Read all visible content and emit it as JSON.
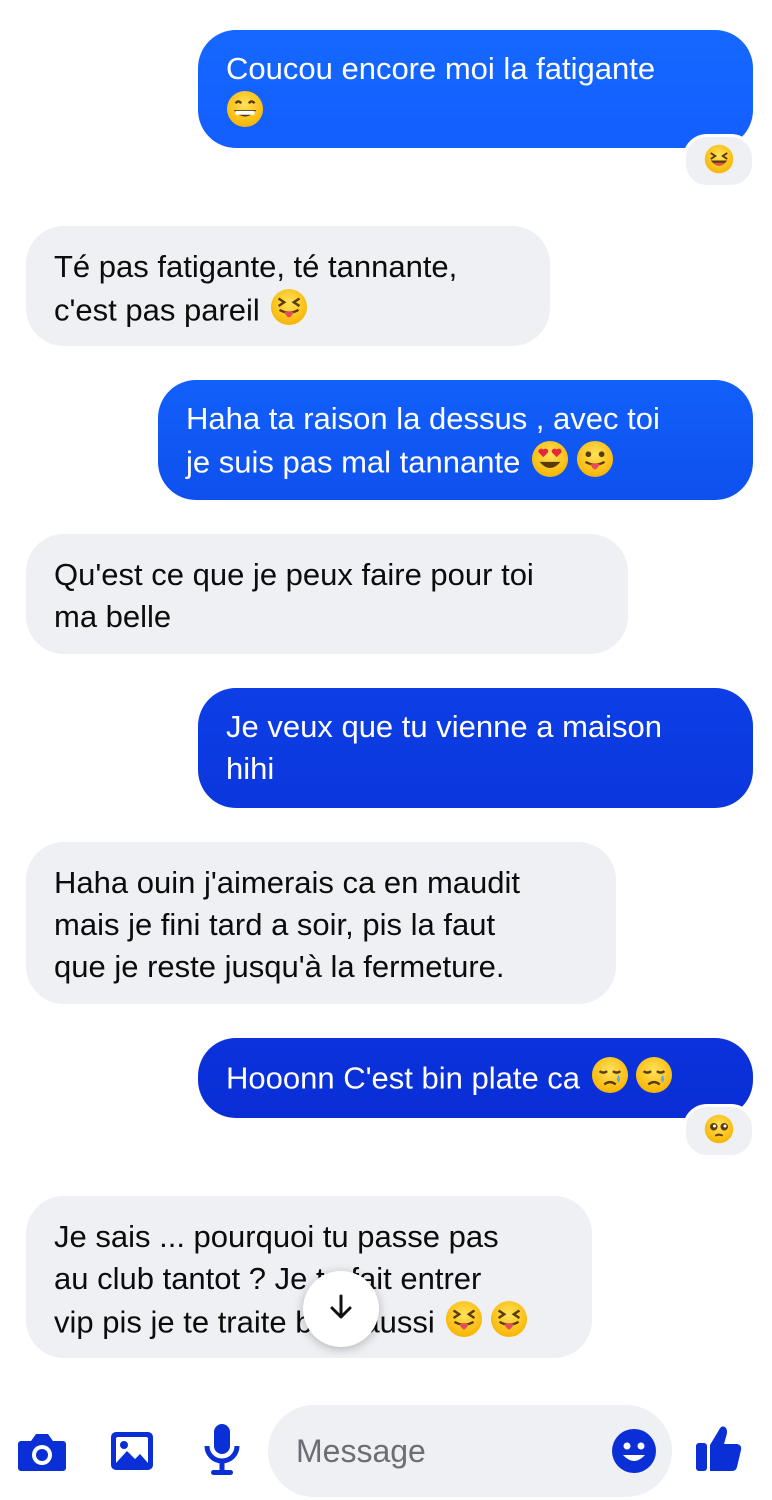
{
  "conversation": {
    "messages": [
      {
        "from": "me",
        "lines": [
          "Coucou encore moi la fatigante",
          ""
        ],
        "emojis": [
          "grinning-face"
        ],
        "reaction": "laughing-face"
      },
      {
        "from": "them",
        "lines": [
          "Té pas fatigante,  té tannante,",
          "c'est pas pareil"
        ],
        "emojis": [
          "squinting-tongue-face"
        ]
      },
      {
        "from": "me",
        "lines": [
          "Haha ta raison la dessus , avec toi",
          "je suis pas mal tannante"
        ],
        "emojis": [
          "heart-eyes-face",
          "tongue-face"
        ]
      },
      {
        "from": "them",
        "lines": [
          "Qu'est ce que je peux faire pour toi",
          "ma belle"
        ]
      },
      {
        "from": "me",
        "lines": [
          "Je veux que tu vienne a maison",
          "hihi"
        ]
      },
      {
        "from": "them",
        "lines": [
          "Haha ouin j'aimerais ca en maudit",
          "mais je fini tard a soir, pis la faut",
          "que je reste jusqu'à  la fermeture."
        ]
      },
      {
        "from": "me",
        "lines": [
          "Hooonn C'est bin plate ca"
        ],
        "emojis": [
          "sad-tear-face",
          "sad-tear-face"
        ],
        "reaction": "pleading-face"
      },
      {
        "from": "them",
        "lines": [
          "Je sais ... pourquoi tu passe pas",
          "au club tantot ? Je te fait entrer",
          "vip pis je te traite bien aussi"
        ],
        "emojis": [
          "squinting-tongue-face",
          "squinting-tongue-face"
        ]
      }
    ]
  },
  "composer": {
    "placeholder": "Message",
    "icons": [
      "camera-icon",
      "gallery-icon",
      "microphone-icon",
      "emoji-icon",
      "thumbs-up-icon"
    ]
  },
  "colors": {
    "accent": "#0a2fd6",
    "outgoing_top": "#1167ff",
    "outgoing_bottom": "#0a2ad0",
    "incoming": "#eff0f3"
  }
}
